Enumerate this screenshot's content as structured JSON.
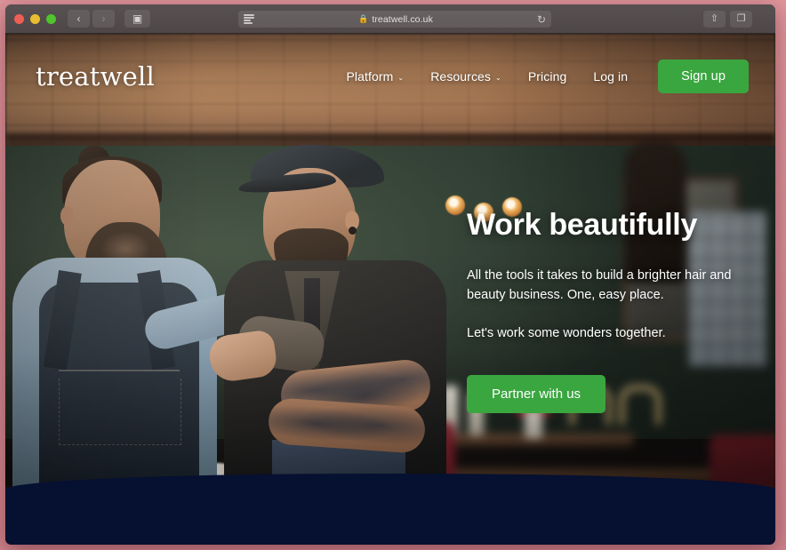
{
  "browser": {
    "traffic_lights": [
      "close",
      "minimize",
      "maximize"
    ],
    "back_label": "‹",
    "forward_label": "›",
    "sidebar_label": "▣",
    "reader_icon": "reader-view-icon",
    "lock_glyph": "🔒",
    "url": "treatwell.co.uk",
    "reload_label": "↻",
    "share_label": "⇧",
    "tabs_label": "❐",
    "new_tab_label": "+"
  },
  "header": {
    "logo": "treatwell",
    "nav": [
      {
        "label": "Platform",
        "has_chevron": true,
        "chevron": "⌄"
      },
      {
        "label": "Resources",
        "has_chevron": true,
        "chevron": "⌄"
      },
      {
        "label": "Pricing",
        "has_chevron": false,
        "chevron": ""
      },
      {
        "label": "Log in",
        "has_chevron": false,
        "chevron": ""
      }
    ],
    "signup_label": "Sign up"
  },
  "hero": {
    "title": "Work beautifully",
    "paragraph_1": "All the tools it takes to build a brighter hair and beauty business. One, easy place.",
    "paragraph_2": "Let's work some wonders together.",
    "cta_label": "Partner with us"
  },
  "colors": {
    "brand_green": "#3aa63f",
    "navy": "#061030",
    "desktop_pink": "#d98f96",
    "text_white": "#ffffff"
  }
}
